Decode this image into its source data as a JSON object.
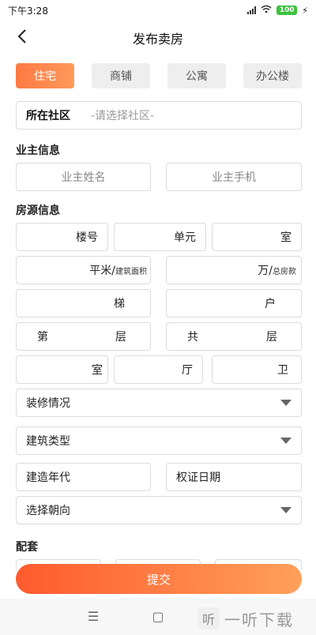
{
  "status": {
    "time": "下午3:28",
    "battery": "100",
    "bolt": "⚡"
  },
  "header": {
    "title": "发布卖房",
    "back_icon": "chevron-left-icon"
  },
  "tabs": [
    {
      "label": "住宅",
      "active": true
    },
    {
      "label": "商铺",
      "active": false
    },
    {
      "label": "公寓",
      "active": false
    },
    {
      "label": "办公楼",
      "active": false
    }
  ],
  "community": {
    "label": "所在社区",
    "placeholder": "-请选择社区-"
  },
  "owner": {
    "title": "业主信息",
    "name_placeholder": "业主姓名",
    "phone_placeholder": "业主手机"
  },
  "house": {
    "title": "房源信息",
    "building_unit": "楼号",
    "unit_unit": "单元",
    "room_unit": "室",
    "area_unit": "平米/",
    "area_sub": "建筑面积",
    "price_unit": "万/",
    "price_sub": "总房款",
    "ladder_unit": "梯",
    "household_unit": "户",
    "floor_prefix": "第",
    "floor_suffix": "层",
    "total_prefix": "共",
    "total_suffix": "层",
    "bedroom_unit": "室",
    "hall_unit": "厅",
    "bath_unit": "卫",
    "decoration": "装修情况",
    "building_type": "建筑类型",
    "build_year": "建造年代",
    "cert_date": "权证日期",
    "orientation": "选择朝向"
  },
  "facilities": {
    "title": "配套"
  },
  "submit_label": "提交",
  "navbar": {
    "menu": "☰",
    "home": "▢",
    "back": "〈"
  },
  "watermark": {
    "badge": "听",
    "text": "一听下载"
  },
  "colors": {
    "accent": "#ff7a45",
    "accent_end": "#ffa05a",
    "border": "#dcdcdc",
    "battery": "#3cc23c"
  }
}
